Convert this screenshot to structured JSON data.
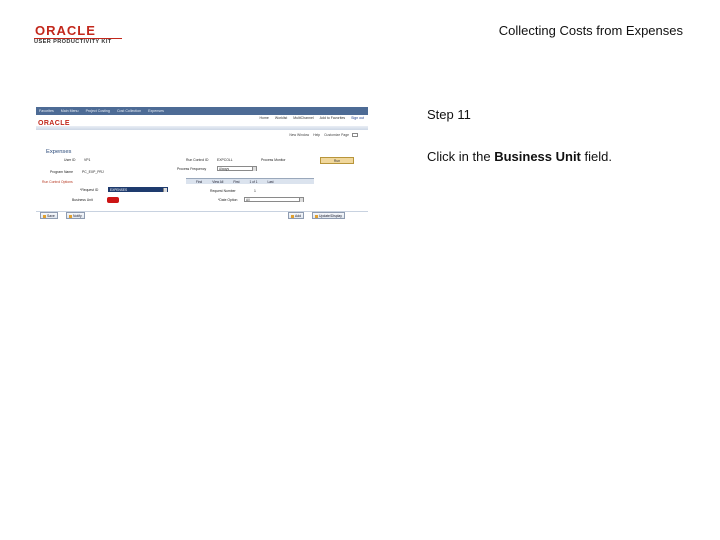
{
  "slide": {
    "logo_main": "ORACLE",
    "logo_sub": "USER PRODUCTIVITY KIT",
    "title": "Collecting Costs from Expenses",
    "step": "Step 11",
    "instruction_pre": "Click in the ",
    "instruction_bold": "Business Unit",
    "instruction_post": " field."
  },
  "screenshot": {
    "menu_items": [
      "Favorites",
      "Main Menu",
      "Project Costing",
      "Cost Collection",
      "Expenses"
    ],
    "brand": "ORACLE",
    "top_links": [
      "Home",
      "Worklist",
      "MultiChannel",
      "Add to Favorites",
      "Sign out"
    ],
    "new_window": [
      "New Window",
      "Help",
      "Customize Page"
    ],
    "heading": "Expenses",
    "labels": {
      "user_id": "User ID",
      "user_id_value": "VP1",
      "run_control_id": "Run Control ID",
      "run_control_value": "EXPCOLL",
      "process_monitor": "Process Monitor",
      "run_button": "Run",
      "program_name": "Program Name",
      "program_name_value": "PC_EXP_PRJ",
      "process_frequency": "Process Frequency",
      "process_frequency_value": "Always",
      "run_control_options": "Run Control Options",
      "request": "*Request ID",
      "request_value": "EXPENSES",
      "business_unit": "Business Unit",
      "request_number": "Request Number",
      "request_number_value": "1",
      "date_option": "*Date Option",
      "date_option_value": "All"
    },
    "grid_header": [
      "Find",
      "View All",
      "First",
      "1 of 1",
      "Last"
    ],
    "buttons": [
      "Save",
      "Notify",
      "Add",
      "Update/Display"
    ]
  }
}
